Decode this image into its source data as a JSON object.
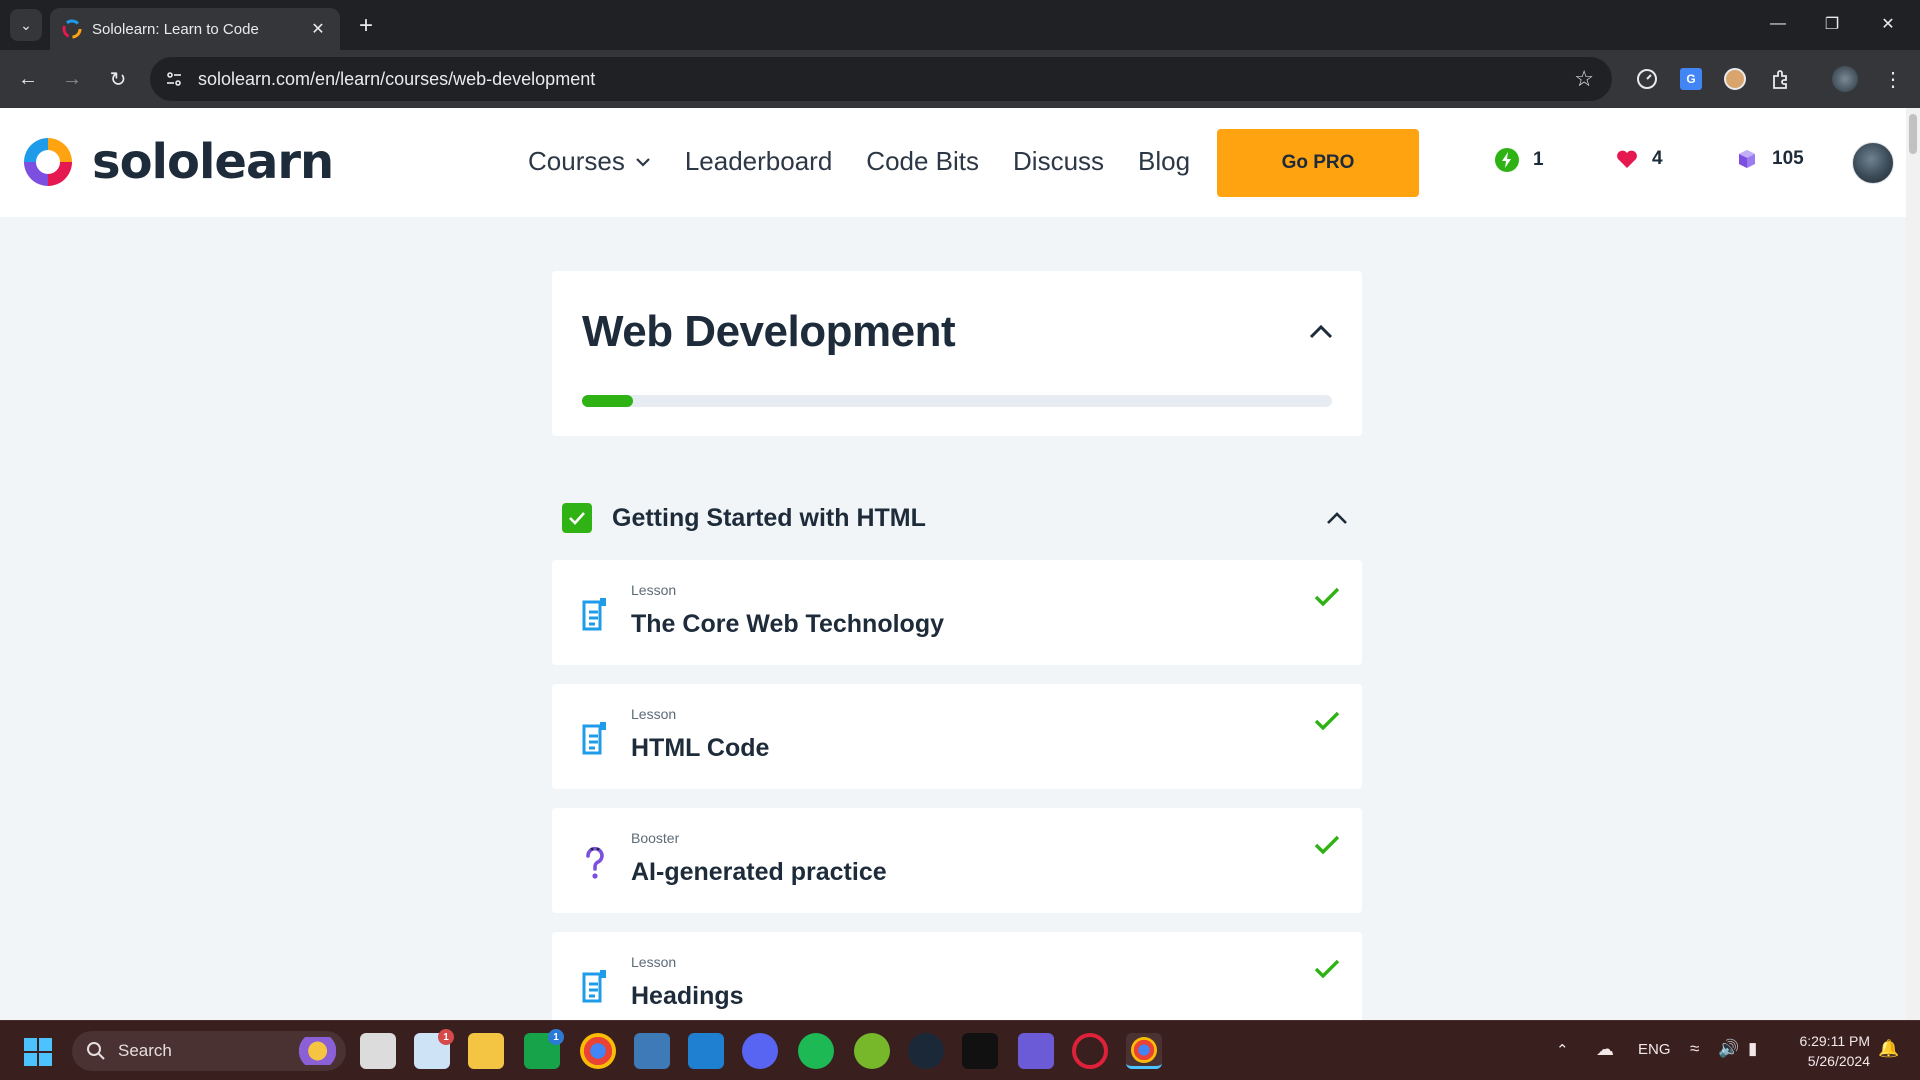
{
  "browser": {
    "tab_title": "Sololearn: Learn to Code",
    "url": "sololearn.com/en/learn/courses/web-development"
  },
  "site": {
    "logo_text": "sololearn",
    "nav": [
      {
        "label": "Courses"
      },
      {
        "label": "Leaderboard"
      },
      {
        "label": "Code Bits"
      },
      {
        "label": "Discuss"
      },
      {
        "label": "Blog"
      }
    ],
    "go_pro_label": "Go PRO",
    "stats": {
      "streak": "1",
      "hearts": "4",
      "bits": "105"
    }
  },
  "course": {
    "title": "Web Development",
    "progress": 0.068
  },
  "module": {
    "title": "Getting Started with HTML",
    "completed": true,
    "lessons": [
      {
        "type": "Lesson",
        "name": "The Core Web Technology",
        "completed": true,
        "icon": "lesson-doc-icon"
      },
      {
        "type": "Lesson",
        "name": "HTML Code",
        "completed": true,
        "icon": "lesson-doc-icon"
      },
      {
        "type": "Booster",
        "name": "AI-generated practice",
        "completed": true,
        "icon": "booster-question-icon"
      },
      {
        "type": "Lesson",
        "name": "Headings",
        "completed": true,
        "icon": "lesson-doc-icon"
      }
    ]
  },
  "colors": {
    "accent_green": "#2fb314",
    "pro_orange": "#ffa310",
    "lesson_blue": "#1e9be9",
    "booster_purple": "#7d4fe0",
    "heart_red": "#e51850"
  },
  "taskbar": {
    "search_label": "Search",
    "tray": {
      "language": "ENG"
    },
    "clock_time": "6:29:11 PM",
    "clock_date": "5/26/2024",
    "badges": {
      "weather": "1",
      "xbox": "1"
    }
  }
}
